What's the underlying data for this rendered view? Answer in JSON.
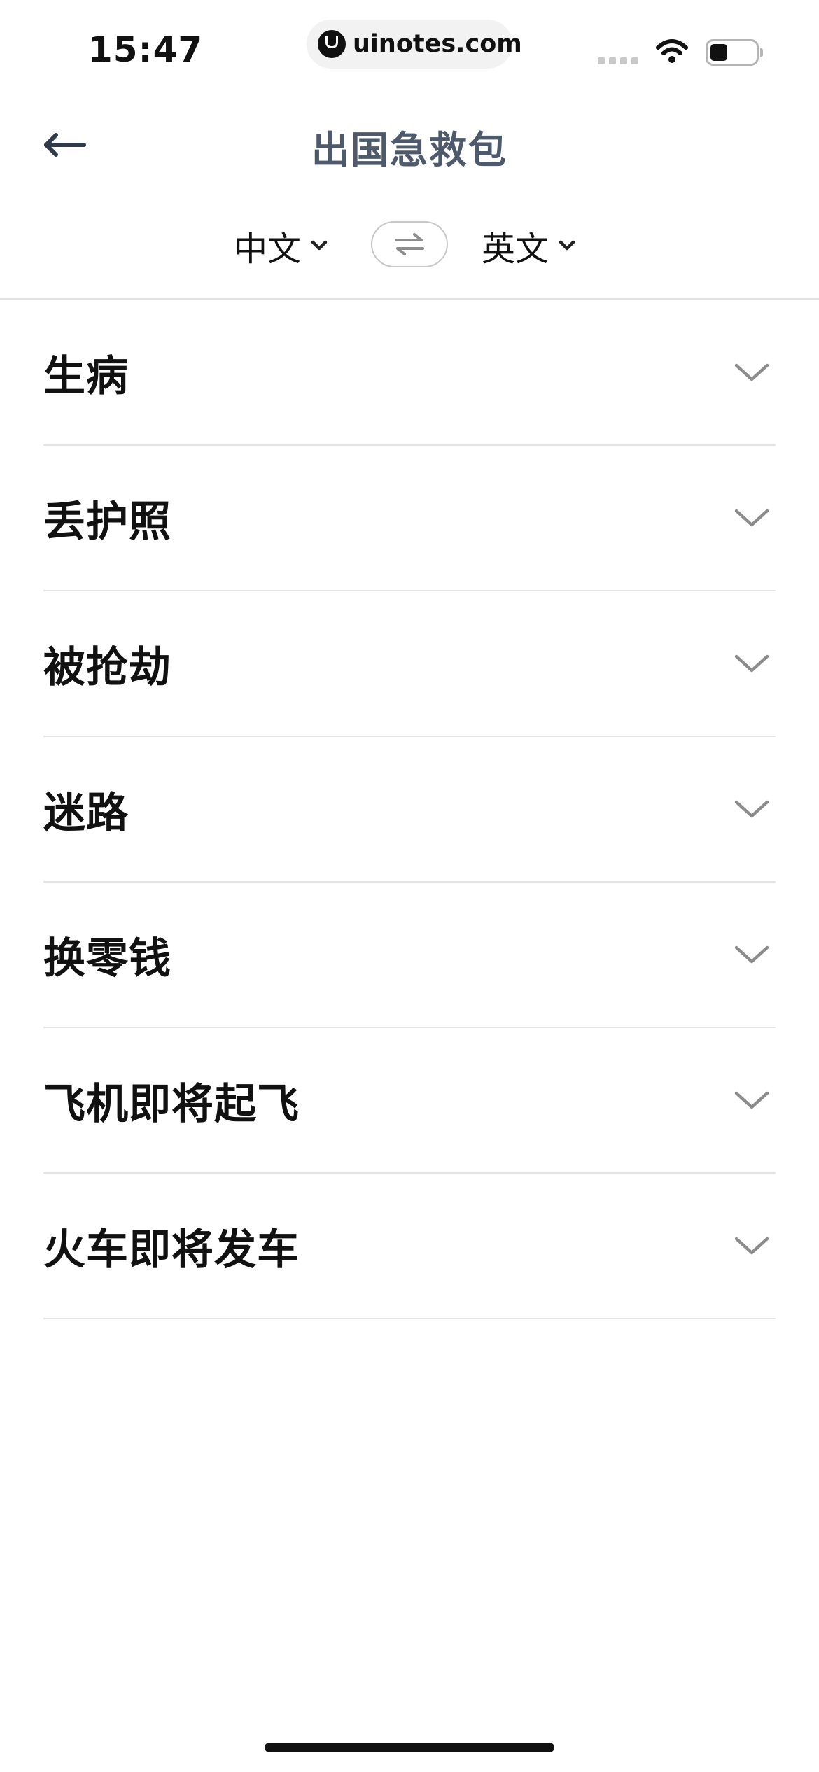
{
  "status_bar": {
    "time": "15:47",
    "url": "uinotes.com",
    "icons": [
      "cellular-signal-icon",
      "wifi-icon",
      "battery-icon"
    ]
  },
  "header": {
    "back_icon": "arrow-left-icon",
    "title": "出国急救包"
  },
  "language": {
    "source": "中文",
    "target": "英文",
    "swap_icon": "swap-arrows-icon",
    "caret_icon": "chevron-down-icon"
  },
  "topics": [
    {
      "label": "生病"
    },
    {
      "label": "丢护照"
    },
    {
      "label": "被抢劫"
    },
    {
      "label": "迷路"
    },
    {
      "label": "换零钱"
    },
    {
      "label": "飞机即将起飞"
    },
    {
      "label": "火车即将发车"
    }
  ],
  "colors": {
    "title": "#4e5a6b",
    "text": "#111111",
    "divider": "#e6e6e6",
    "chevron": "#8c8c8c"
  }
}
